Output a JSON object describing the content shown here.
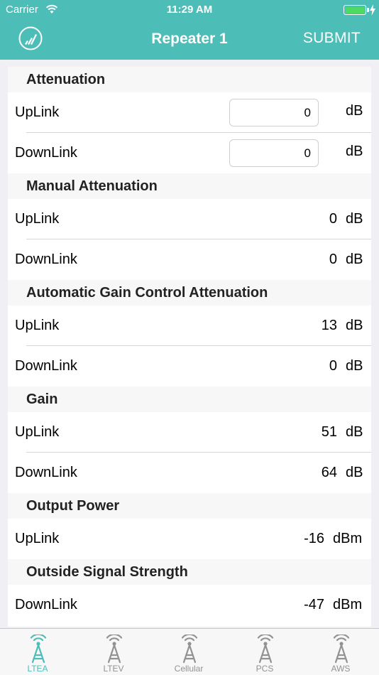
{
  "status_bar": {
    "carrier": "Carrier",
    "time": "11:29 AM",
    "battery_level": 1.0,
    "charging": true
  },
  "nav": {
    "title": "Repeater 1",
    "submit_label": "SUBMIT",
    "logo_icon": "signal-bars-icon",
    "bar_color": "#4cbdb7"
  },
  "sections": {
    "attenuation": {
      "title": "Attenuation",
      "uplink": {
        "label": "UpLink",
        "value": "0",
        "unit": "dB"
      },
      "downlink": {
        "label": "DownLink",
        "value": "0",
        "unit": "dB"
      }
    },
    "manual_attenuation": {
      "title": "Manual Attenuation",
      "uplink": {
        "label": "UpLink",
        "value": "0",
        "unit": "dB"
      },
      "downlink": {
        "label": "DownLink",
        "value": "0",
        "unit": "dB"
      }
    },
    "agc_attenuation": {
      "title": "Automatic Gain Control Attenuation",
      "uplink": {
        "label": "UpLink",
        "value": "13",
        "unit": "dB"
      },
      "downlink": {
        "label": "DownLink",
        "value": "0",
        "unit": "dB"
      }
    },
    "gain": {
      "title": "Gain",
      "uplink": {
        "label": "UpLink",
        "value": "51",
        "unit": "dB"
      },
      "downlink": {
        "label": "DownLink",
        "value": "64",
        "unit": "dB"
      }
    },
    "output_power": {
      "title": "Output Power",
      "uplink": {
        "label": "UpLink",
        "value": "-16",
        "unit": "dBm"
      }
    },
    "outside_signal": {
      "title": "Outside Signal Strength",
      "downlink": {
        "label": "DownLink",
        "value": "-47",
        "unit": "dBm"
      }
    }
  },
  "tabs": [
    {
      "label": "LTEA",
      "icon": "antenna-tower-icon",
      "active": true
    },
    {
      "label": "LTEV",
      "icon": "antenna-tower-icon",
      "active": false
    },
    {
      "label": "Cellular",
      "icon": "antenna-tower-icon",
      "active": false
    },
    {
      "label": "PCS",
      "icon": "antenna-tower-icon",
      "active": false
    },
    {
      "label": "AWS",
      "icon": "antenna-tower-icon",
      "active": false
    }
  ],
  "colors": {
    "accent": "#4cbdb7",
    "inactive_tab": "#929292"
  }
}
